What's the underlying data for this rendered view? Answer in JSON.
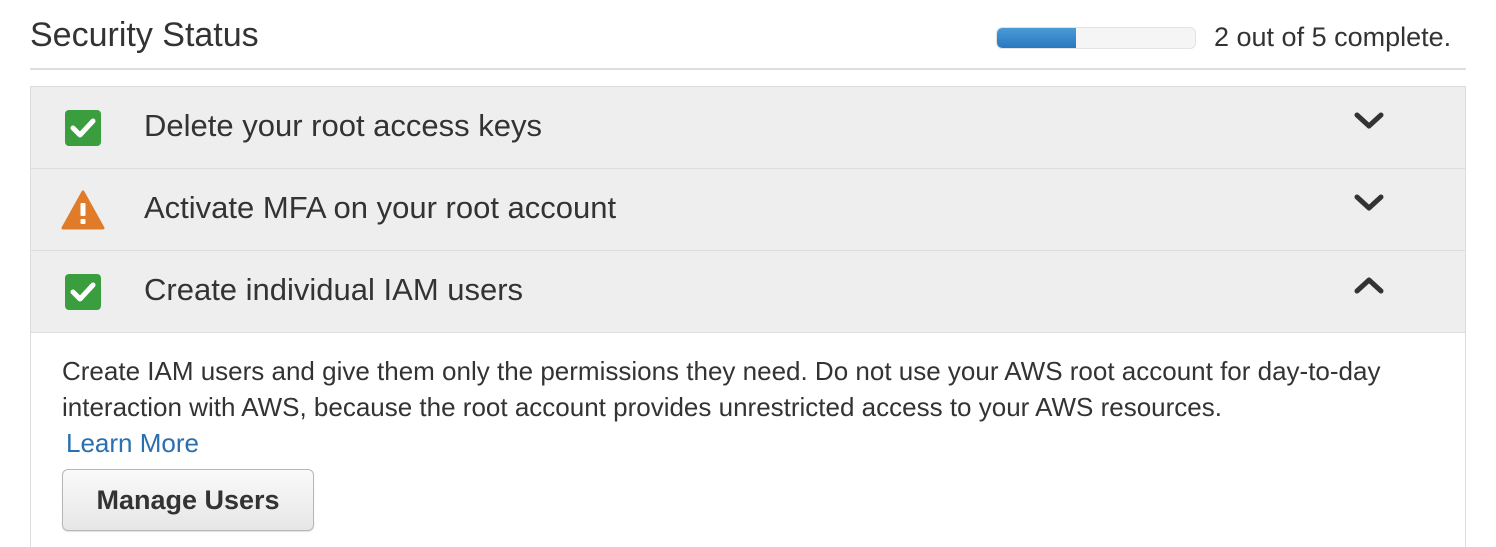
{
  "header": {
    "title": "Security Status",
    "progress": {
      "completed": 2,
      "total": 5,
      "fraction": 0.4,
      "text": "2 out of 5 complete."
    }
  },
  "items": [
    {
      "label": "Delete your root access keys",
      "status": "complete",
      "status_icon": "check-icon",
      "expanded": false,
      "toggle_icon": "chevron-down-icon"
    },
    {
      "label": "Activate MFA on your root account",
      "status": "warning",
      "status_icon": "warning-icon",
      "expanded": false,
      "toggle_icon": "chevron-down-icon"
    },
    {
      "label": "Create individual IAM users",
      "status": "complete",
      "status_icon": "check-icon",
      "expanded": true,
      "toggle_icon": "chevron-up-icon"
    }
  ],
  "detail": {
    "description": "Create IAM users and give them only the permissions they need. Do not use your AWS root account for day-to-day interaction with AWS, because the root account provides unrestricted access to your AWS resources.",
    "learn_more": "Learn More",
    "button_label": "Manage Users"
  },
  "colors": {
    "complete": "#3a9d3e",
    "warning": "#e07b2a",
    "progress": "#2f7ec4",
    "link": "#2a6fb0"
  }
}
